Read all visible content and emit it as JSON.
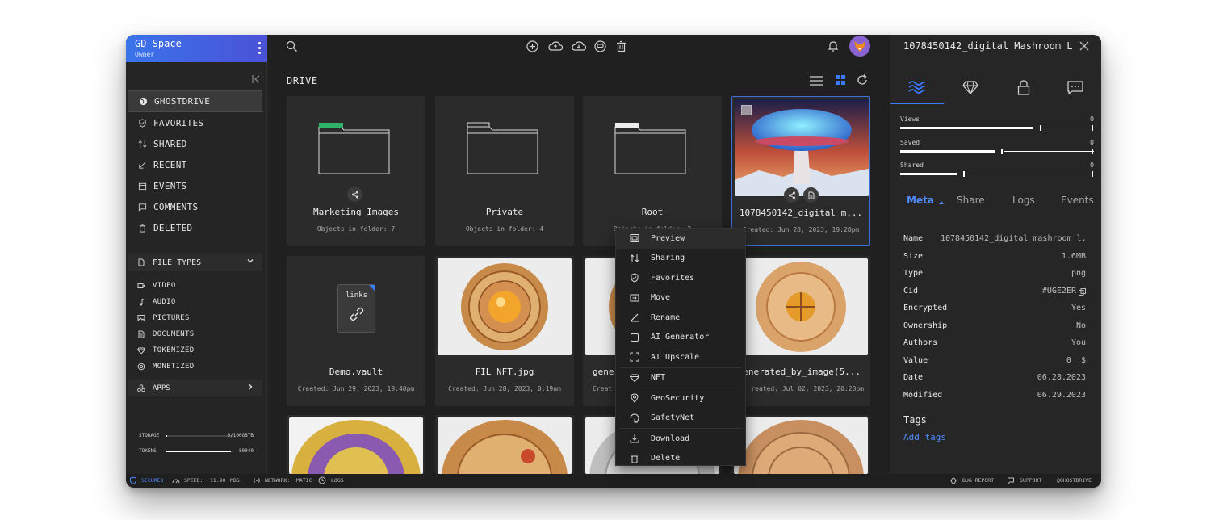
{
  "space": {
    "name": "GD Space",
    "role": "Owner"
  },
  "nav": [
    {
      "label": "GHOSTDRIVE",
      "icon": "globe-icon",
      "active": true
    },
    {
      "label": "FAVORITES",
      "icon": "shield-check-icon"
    },
    {
      "label": "SHARED",
      "icon": "share-arrows-icon"
    },
    {
      "label": "RECENT",
      "icon": "recent-arrow-icon"
    },
    {
      "label": "EVENTS",
      "icon": "calendar-icon"
    },
    {
      "label": "COMMENTS",
      "icon": "comment-icon"
    },
    {
      "label": "DELETED",
      "icon": "trash-icon"
    }
  ],
  "file_types": {
    "label": "FILE TYPES",
    "items": [
      {
        "label": "VIDEO",
        "icon": "video-icon"
      },
      {
        "label": "AUDIO",
        "icon": "music-note-icon"
      },
      {
        "label": "PICTURES",
        "icon": "picture-icon"
      },
      {
        "label": "DOCUMENTS",
        "icon": "document-icon"
      },
      {
        "label": "TOKENIZED",
        "icon": "diamond-icon"
      },
      {
        "label": "MONETIZED",
        "icon": "coin-icon"
      }
    ]
  },
  "apps": {
    "label": "APPS"
  },
  "storage": {
    "label": "STORAGE",
    "value": "0/100GBTB",
    "fill": 0.01
  },
  "tokens": {
    "label": "TOKENS",
    "value": "80040",
    "fill": 0.98
  },
  "main": {
    "title": "DRIVE",
    "cards": [
      {
        "title": "Marketing Images",
        "sub": "Objects in folder: 7"
      },
      {
        "title": "Private",
        "sub": "Objects in folder: 4"
      },
      {
        "title": "Root",
        "sub": "Objects in folder: 2"
      },
      {
        "title": "1078450142_digital m...",
        "sub": "Created: Jun 28, 2023, 19:28pm"
      },
      {
        "title": "Demo.vault",
        "sub": "Created: Jun 29, 2023, 19:48pm",
        "badge": "links"
      },
      {
        "title": "FIL NFT.jpg",
        "sub": "Created: Jun 28, 2023, 0:19am"
      },
      {
        "title": "gener",
        "sub": "Creat"
      },
      {
        "title": "enerated_by_image(5...",
        "sub": "reated: Jul 02, 2023, 20:28pm"
      }
    ]
  },
  "context_menu": [
    {
      "label": "Preview",
      "icon": "preview-icon"
    },
    {
      "label": "Sharing",
      "icon": "share-arrows-icon"
    },
    {
      "label": "Favorites",
      "icon": "shield-check-icon"
    },
    {
      "label": "Move",
      "icon": "move-icon"
    },
    {
      "label": "Rename",
      "icon": "pen-icon"
    },
    {
      "label": "AI Generator",
      "icon": "square-icon"
    },
    {
      "label": "AI Upscale",
      "icon": "expand-icon"
    },
    {
      "label": "NFT",
      "icon": "diamond-icon"
    },
    {
      "label": "GeoSecurity",
      "icon": "location-pin-icon"
    },
    {
      "label": "SafetyNet",
      "icon": "safety-net-icon"
    },
    {
      "label": "Download",
      "icon": "download-icon"
    },
    {
      "label": "Delete",
      "icon": "trash-icon"
    }
  ],
  "panel": {
    "title": "1078450142_digital Mashroom La...",
    "stats": [
      {
        "label": "Views",
        "value": "0"
      },
      {
        "label": "Saved",
        "value": "0"
      },
      {
        "label": "Shared",
        "value": "0"
      }
    ],
    "subtabs": [
      "Meta",
      "Share",
      "Logs",
      "Events"
    ],
    "meta": [
      {
        "k": "Name",
        "v": "1078450142_digital mashroom l..."
      },
      {
        "k": "Size",
        "v": "1.6MB"
      },
      {
        "k": "Type",
        "v": "png"
      },
      {
        "k": "Cid",
        "v": "#UGE2ER"
      },
      {
        "k": "Encrypted",
        "v": "Yes"
      },
      {
        "k": "Ownership",
        "v": "No"
      },
      {
        "k": "Authors",
        "v": "You"
      },
      {
        "k": "Value",
        "v": "0  $"
      },
      {
        "k": "Date",
        "v": "06.28.2023"
      },
      {
        "k": "Modified",
        "v": "06.29.2023"
      }
    ],
    "tags_title": "Tags",
    "add_tags": "Add tags"
  },
  "statusbar": {
    "secured": "SECURED",
    "speed_label": "SPEED:",
    "speed_value": "11.90",
    "speed_unit": "MBS",
    "network_label": "NETWORK:",
    "network_value": "MATIC",
    "logs": "LOGS",
    "bug_report": "BUG REPORT",
    "support": "SUPPORT",
    "handle": "@GHOSTDRIVE"
  },
  "colors": {
    "accent": "#3a7bff",
    "header_gradient_start": "#3a73ea",
    "header_gradient_end": "#4a52d8"
  }
}
